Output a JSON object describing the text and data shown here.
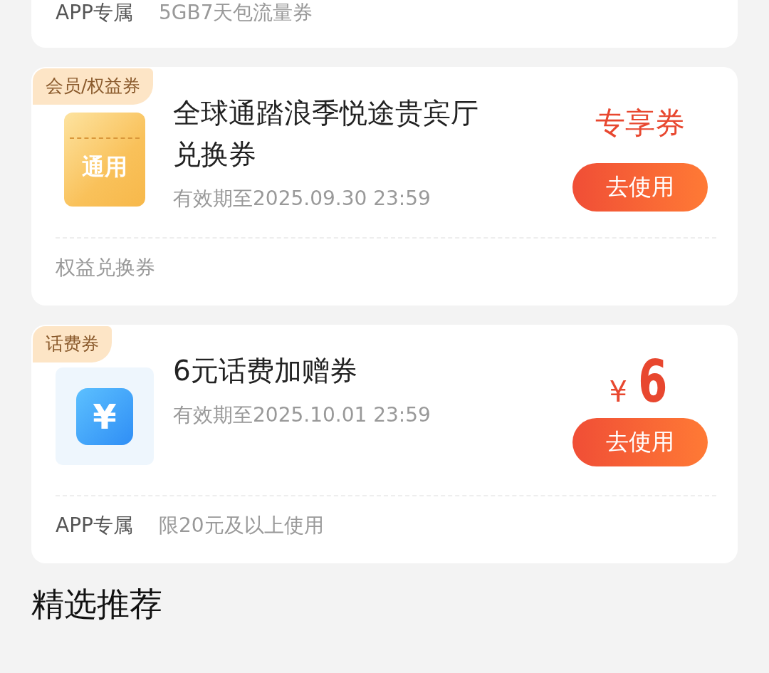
{
  "cards": [
    {
      "partial": true,
      "footer": [
        {
          "text": "APP专属",
          "kind": "tag"
        },
        {
          "text": "5GB7天包流量券",
          "kind": "note"
        }
      ]
    },
    {
      "partial": false,
      "tag": "会员/权益券",
      "icon": {
        "kind": "ticket",
        "text": "通用"
      },
      "title": "全球通踏浪季悦途贵宾厅兑换券",
      "validity": "有效期至2025.09.30 23:59",
      "value": {
        "kind": "label",
        "text": "专享券"
      },
      "button": "去使用",
      "footer": [
        {
          "text": "权益兑换券",
          "kind": "note"
        }
      ]
    },
    {
      "partial": false,
      "tag": "话费券",
      "icon": {
        "kind": "yuan",
        "text": "¥"
      },
      "title": "6元话费加赠券",
      "validity": "有效期至2025.10.01 23:59",
      "value": {
        "kind": "price",
        "currency": "¥",
        "amount": "6"
      },
      "button": "去使用",
      "footer": [
        {
          "text": "APP专属",
          "kind": "tag"
        },
        {
          "text": "限20元及以上使用",
          "kind": "note"
        }
      ]
    }
  ],
  "section_title": "精选推荐"
}
